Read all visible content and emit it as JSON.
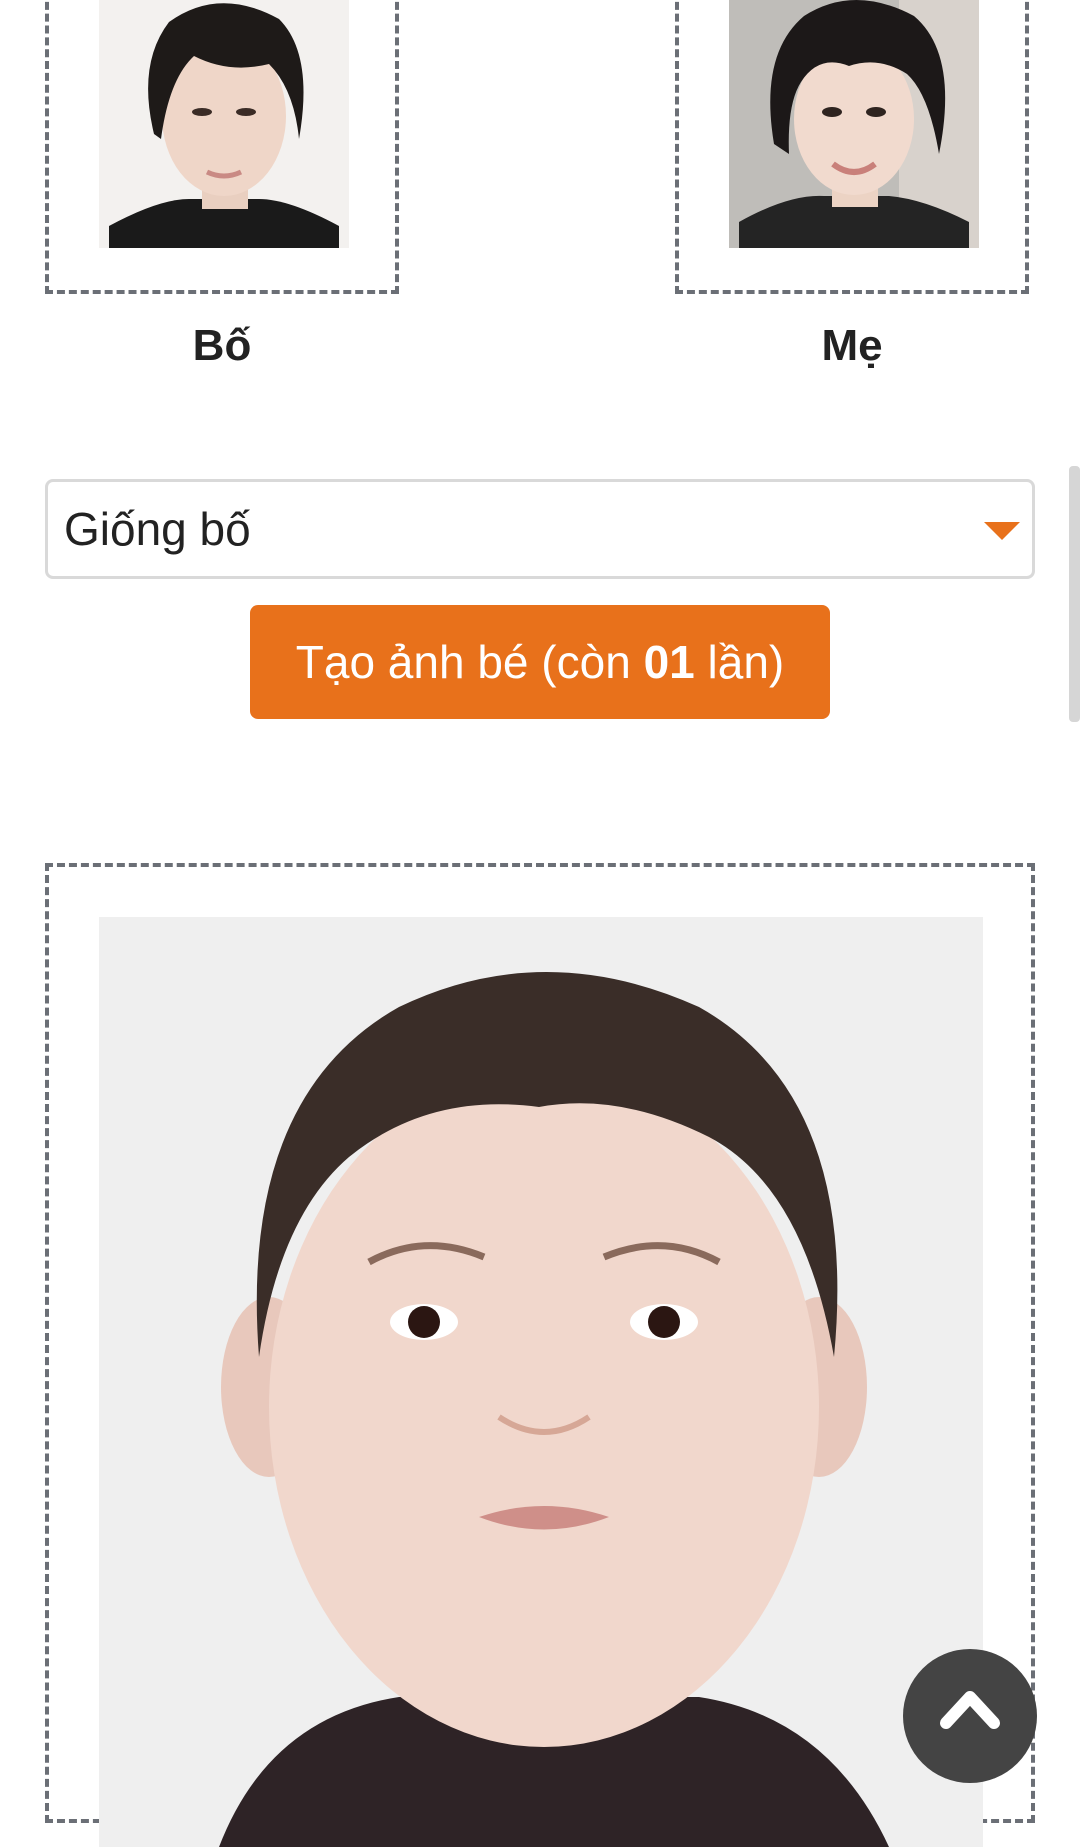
{
  "parents": {
    "father": {
      "label": "Bố",
      "photo_icon": "father-portrait-photo"
    },
    "mother": {
      "label": "Mẹ",
      "photo_icon": "mother-portrait-photo"
    }
  },
  "resemblance_select": {
    "selected": "Giống bố",
    "caret_icon": "caret-down-icon"
  },
  "generate_button": {
    "prefix": "Tạo ảnh bé (còn ",
    "count": "01",
    "suffix": " lần)"
  },
  "result": {
    "photo_icon": "baby-portrait-photo"
  },
  "back_to_top": {
    "icon": "chevron-up-icon"
  },
  "colors": {
    "accent": "#e8711b",
    "frame_border": "#6b6f76",
    "back_to_top_bg": "#444444"
  }
}
